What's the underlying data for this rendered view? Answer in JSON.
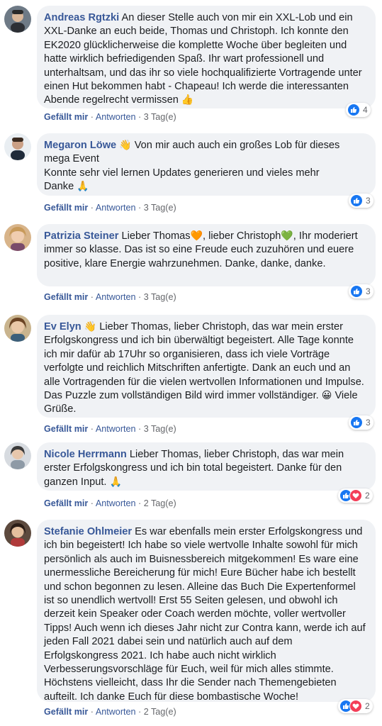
{
  "comments": [
    {
      "author": "Andreas Rgtzki",
      "text": "An dieser Stelle auch von mir ein XXL-Lob und ein XXL-Danke an euch beide, Thomas und Christoph. Ich konnte den EK2020 glücklicherweise die komplette Woche über begleiten und hatte wirklich befriedigenden Spaß. Ihr wart professionell und unterhaltsam, und das ihr so viele hochqualifizierte Vortragende unter einen Hut bekommen habt - Chapeau! Ich werde die interessanten Abende regelrecht vermissen",
      "emoji": "👍",
      "like_label": "Gefällt mir",
      "reply_label": "Antworten",
      "time": "3 Tag(e)",
      "reaction_count": "4",
      "reactions": [
        "like-icon"
      ]
    },
    {
      "author": "Megaron Löwe",
      "author_emoji": "👋",
      "text": "Von mir auch auch ein großes Lob für dieses mega Event",
      "text2": "Konnte sehr viel lernen Updates generieren und vieles mehr",
      "text3": "Danke",
      "emoji": "🙏",
      "like_label": "Gefällt mir",
      "reply_label": "Antworten",
      "time": "3 Tag(e)",
      "reaction_count": "3",
      "reactions": [
        "like-icon"
      ]
    },
    {
      "author": "Patrizia Steiner",
      "text_a": "Lieber Thomas",
      "heart1": "🧡",
      "text_b": ", lieber Christoph",
      "heart2": "💚",
      "text_c": ", Ihr moderiert immer so klasse. Das ist so eine Freude euch zuzuhören und euere positive, klare Energie wahrzunehmen. Danke, danke, danke.",
      "like_label": "Gefällt mir",
      "reply_label": "Antworten",
      "time": "3 Tag(e)",
      "reaction_count": "3",
      "reactions": [
        "like-icon"
      ]
    },
    {
      "author": "Ev Elyn",
      "author_emoji": "👋",
      "text": "Lieber Thomas, lieber Christoph, das war mein erster Erfolgskongress und ich bin überwältigt begeistert. Alle Tage konnte ich mir dafür ab 17Uhr so organisieren, dass ich viele Vorträge verfolgte und reichlich Mitschriften anfertigte. Dank an euch und an alle Vortragenden für die vielen wertvollen Informationen und Impulse. Das Puzzle zum vollständigen Bild wird immer vollständiger.",
      "emoji": "😀",
      "text_end": "Viele Grüße.",
      "like_label": "Gefällt mir",
      "reply_label": "Antworten",
      "time": "3 Tag(e)",
      "reaction_count": "3",
      "reactions": [
        "like-icon"
      ]
    },
    {
      "author": "Nicole Herrmann",
      "text": "Lieber Thomas, lieber Christoph, das war mein erster Erfolgskongress und ich bin total begeistert. Danke für den ganzen Input.",
      "emoji": "🙏",
      "like_label": "Gefällt mir",
      "reply_label": "Antworten",
      "time": "2 Tag(e)",
      "reaction_count": "2",
      "reactions": [
        "like-icon",
        "love-icon"
      ]
    },
    {
      "author": "Stefanie Ohlmeier",
      "text": "Es war ebenfalls mein erster Erfolgskongress und ich bin begeistert! Ich habe so viele wertvolle Inhalte sowohl für mich persönlich als auch im Buisnessbereich mitgekommen! Es ware eine unermessliche Bereicherung für mich! Eure Bücher habe ich bestellt und schon begonnen zu lesen. Alleine das Buch Die Expertenformel ist so unendlich wertvoll! Erst 55 Seiten gelesen, und obwohl ich derzeit kein Speaker oder Coach werden möchte, voller wertvoller Tipps! Auch wenn ich dieses Jahr nicht zur Contra kann, werde ich auf jeden Fall 2021 dabei sein und natürlich auch auf dem Erfolgskongress 2021. Ich habe auch nicht wirklich Verbesserungsvorschläge für Euch, weil für mich alles stimmte. Höchstens vielleicht, dass Ihr die Sender nach Themengebieten aufteilt. Ich danke Euch für diese bombastische Woche!",
      "like_label": "Gefällt mir",
      "reply_label": "Antworten",
      "time": "2 Tag(e)",
      "reaction_count": "2",
      "reactions": [
        "like-icon",
        "love-icon"
      ]
    }
  ],
  "separator": "·",
  "colors": {
    "bubble": "#f0f2f5",
    "author": "#385898",
    "meta": "#65676b",
    "like_blue": "#1877f2",
    "love_red": "#f33e58"
  }
}
